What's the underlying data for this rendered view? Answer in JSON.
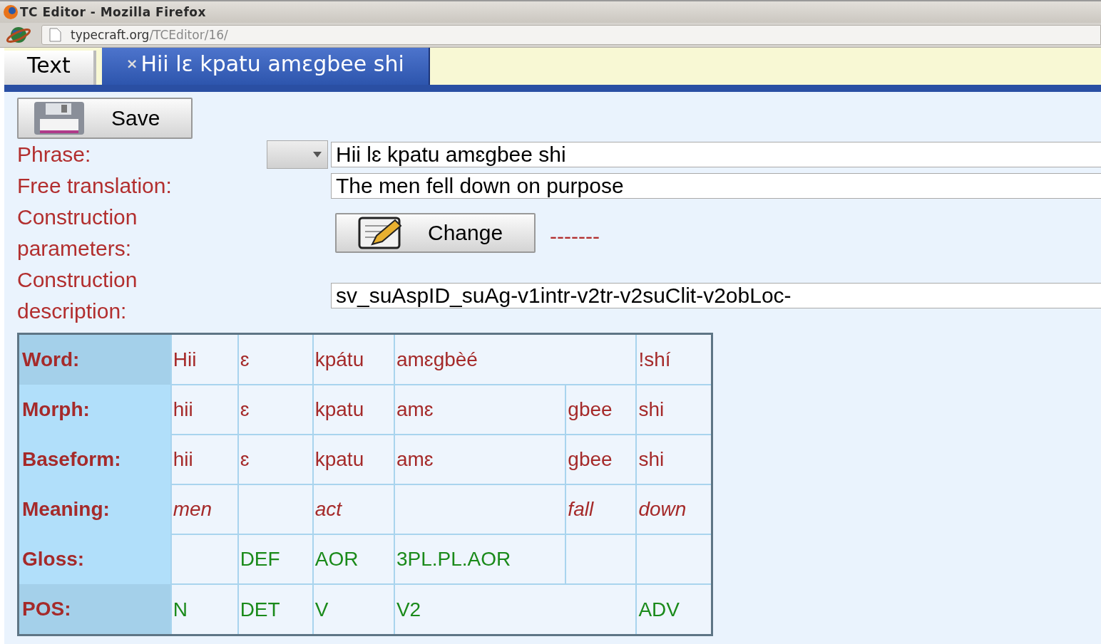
{
  "window": {
    "title": "TC Editor - Mozilla Firefox"
  },
  "address_bar": {
    "domain": "typecraft.org",
    "path": "/TCEditor/16/"
  },
  "tabs": [
    {
      "label": "Text",
      "selected": false
    },
    {
      "label": "Hii lɛ kpatu amɛgbee shi",
      "selected": true,
      "close_glyph": "×"
    }
  ],
  "save_button": {
    "label": "Save"
  },
  "form": {
    "phrase": {
      "label": "Phrase:",
      "value": "Hii lɛ kpatu amɛgbee shi"
    },
    "free_translation": {
      "label": "Free translation:",
      "value": "The men fell down on purpose"
    },
    "construction_parameters": {
      "label": "Construction parameters:",
      "button": "Change",
      "value": "-------"
    },
    "construction_description": {
      "label": "Construction description:",
      "value": "sv_suAspID_suAg-v1intr-v2tr-v2suClit-v2obLoc-"
    }
  },
  "gloss_table": {
    "rows": [
      {
        "label": "Word:",
        "kind": "word",
        "cells": [
          {
            "text": "Hii"
          },
          {
            "text": "ɛ"
          },
          {
            "text": "kpátu"
          },
          {
            "text": "amɛgbèé",
            "colspan": 2
          },
          {
            "text": "!shí"
          }
        ]
      },
      {
        "label": "Morph:",
        "kind": "morph",
        "cells": [
          {
            "text": "hii"
          },
          {
            "text": "ɛ"
          },
          {
            "text": "kpatu"
          },
          {
            "text": "amɛ"
          },
          {
            "text": "gbee"
          },
          {
            "text": "shi"
          }
        ]
      },
      {
        "label": "Baseform:",
        "kind": "morph",
        "cells": [
          {
            "text": "hii"
          },
          {
            "text": "ɛ"
          },
          {
            "text": "kpatu"
          },
          {
            "text": "amɛ"
          },
          {
            "text": "gbee"
          },
          {
            "text": "shi"
          }
        ]
      },
      {
        "label": "Meaning:",
        "kind": "meaning",
        "cells": [
          {
            "text": "men"
          },
          {},
          {
            "text": "act"
          },
          {},
          {
            "text": "fall"
          },
          {
            "text": "down"
          }
        ]
      },
      {
        "label": "Gloss:",
        "kind": "gloss",
        "cells": [
          {},
          {
            "text": "DEF"
          },
          {
            "text": "AOR"
          },
          {
            "text": "3PL.PL.AOR"
          },
          {},
          {}
        ]
      },
      {
        "label": "POS:",
        "kind": "pos",
        "cells": [
          {
            "text": "N"
          },
          {
            "text": "DET"
          },
          {
            "text": "V"
          },
          {
            "text": "V2",
            "colspan": 2
          },
          {
            "text": "ADV"
          }
        ]
      }
    ]
  }
}
